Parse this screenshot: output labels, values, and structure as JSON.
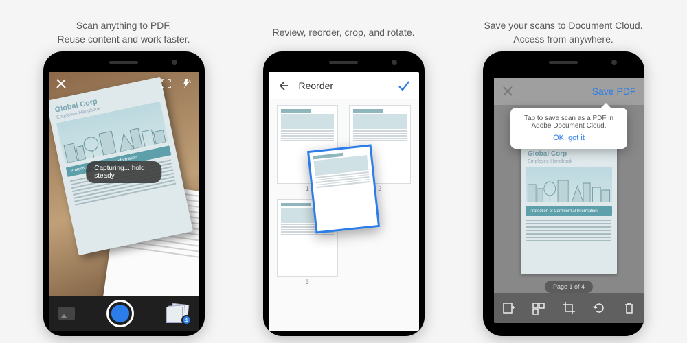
{
  "panel1": {
    "caption": "Scan anything to PDF.\nReuse content and work faster.",
    "toast": "Capturing... hold steady",
    "doc_title": "Global Corp",
    "doc_subtitle": "Employee Handbook",
    "doc_band": "Protection of Confidential Information",
    "badge_count": "4"
  },
  "panel2": {
    "caption": "Review, reorder, crop, and rotate.",
    "title": "Reorder",
    "page_labels": [
      "1",
      "2",
      "3"
    ]
  },
  "panel3": {
    "caption": "Save your scans to Document Cloud.\nAccess from anywhere.",
    "save_label": "Save PDF",
    "popover_text": "Tap to save scan as a PDF in Adobe Document Cloud.",
    "popover_ok": "OK, got it",
    "doc_title": "Global Corp",
    "doc_subtitle": "Employee Handbook",
    "doc_band": "Protection of Confidential Information",
    "page_pill": "Page 1 of 4"
  }
}
